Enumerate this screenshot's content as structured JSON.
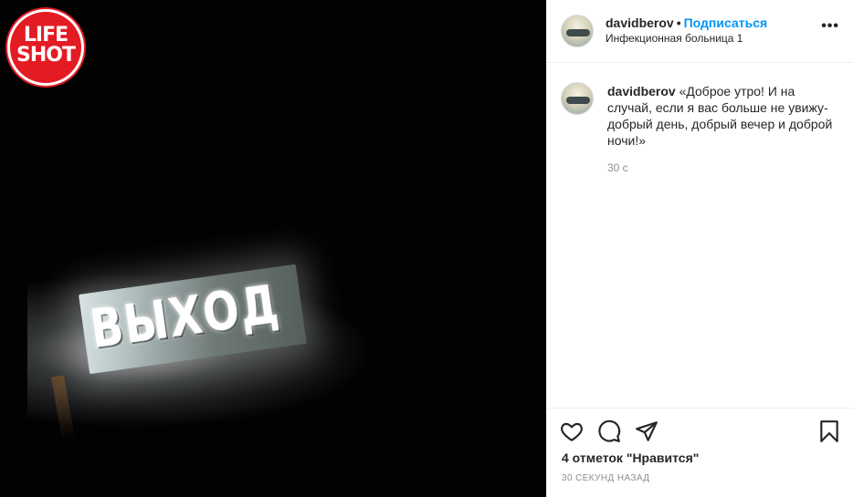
{
  "watermark": {
    "line1": "LIFE",
    "line2": "SHOT"
  },
  "photo": {
    "sign_text": "ВЫХОД"
  },
  "header": {
    "username": "davidberov",
    "separator": "•",
    "follow_label": "Подписаться",
    "location": "Инфекционная больница 1",
    "more_label": "•••"
  },
  "comment": {
    "username": "davidberov",
    "text": "«Доброе утро! И на случай, если я вас больше не увижу- добрый день, добрый вечер и доброй ночи!»",
    "time": "30 с"
  },
  "actions": {
    "like_icon": "heart-icon",
    "comment_icon": "comment-icon",
    "share_icon": "send-icon",
    "save_icon": "bookmark-icon",
    "likes_text": "4 отметок \"Нравится\"",
    "posted_ago": "30 СЕКУНД НАЗАД"
  }
}
